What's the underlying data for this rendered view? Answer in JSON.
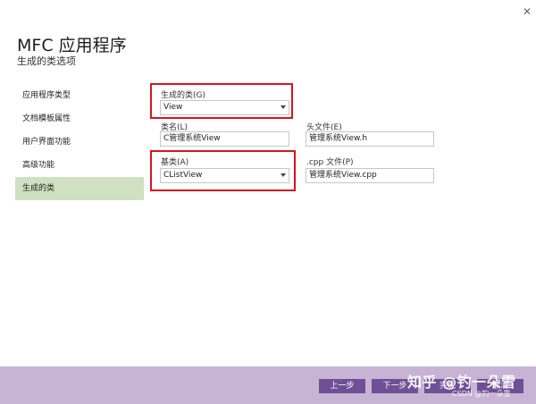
{
  "window": {
    "title": "MFC 应用程序",
    "subtitle": "生成的类选项",
    "close_glyph": "✕"
  },
  "sidebar": {
    "items": [
      {
        "label": "应用程序类型"
      },
      {
        "label": "文档模板属性"
      },
      {
        "label": "用户界面功能"
      },
      {
        "label": "高级功能"
      },
      {
        "label": "生成的类",
        "active": true
      }
    ]
  },
  "form": {
    "generated_class_label": "生成的类(G)",
    "generated_class_value": "View",
    "class_name_label": "类名(L)",
    "class_name_value": "C管理系统View",
    "header_label": "头文件(E)",
    "header_value": "管理系统View.h",
    "base_class_label": "基类(A)",
    "base_class_value": "CListView",
    "cpp_label": ".cpp 文件(P)",
    "cpp_value": "管理系统View.cpp"
  },
  "footer": {
    "prev_label": "上一步",
    "next_label": "下一步",
    "finish_label": "完成",
    "cancel_label": "取消"
  },
  "watermark": {
    "text": "知乎 @钓一朵雪",
    "sub": "CSDN @钓一朵雪"
  },
  "colors": {
    "accent": "#6f4f95",
    "footer_bg": "#c7b4d4",
    "highlight": "#d9141c",
    "nav_active": "#cfe1c0"
  }
}
